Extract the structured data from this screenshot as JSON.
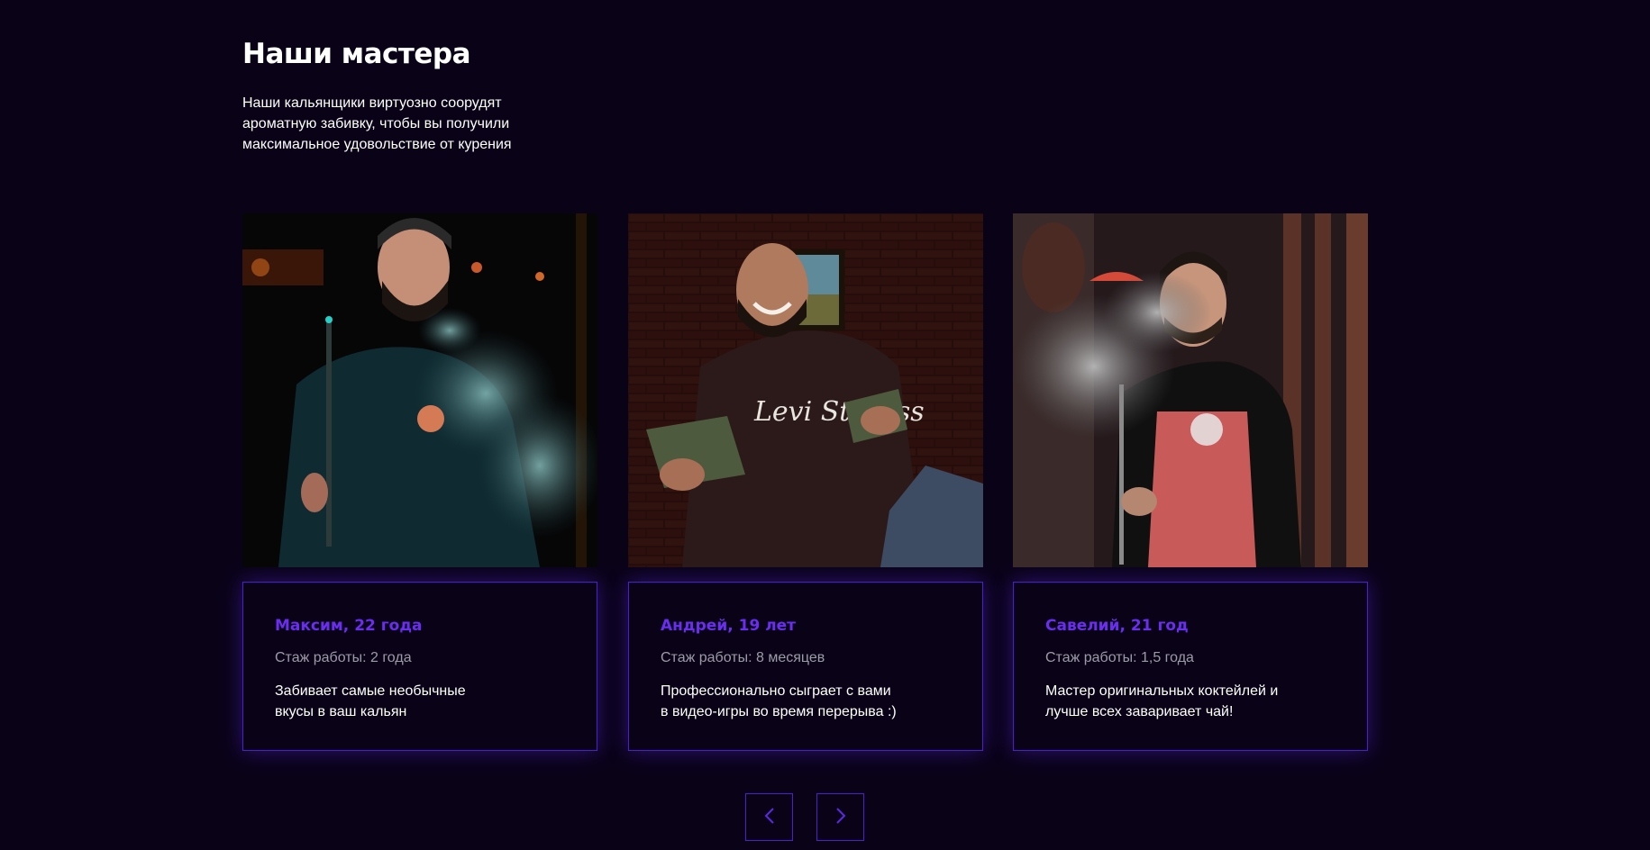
{
  "section": {
    "title": "Наши мастера",
    "description": "Наши кальянщики виртуозно соорудят ароматную забивку, чтобы вы получили максимальное удовольствие от курения"
  },
  "colors": {
    "background": "#0a0318",
    "accent": "#6a2ef0",
    "border": "#4b1fd0",
    "muted_text": "#9d9aa8"
  },
  "masters": [
    {
      "name": "Максим, 22 года",
      "experience": "Стаж работы: 2 года",
      "about": "Забивает самые необычные\nвкусы в ваш кальян"
    },
    {
      "name": "Андрей, 19 лет",
      "experience": "Стаж работы: 8 месяцев",
      "about": "Профессионально сыграет с вами\nв видео-игры во время перерыва :)"
    },
    {
      "name": "Савелий, 21 год",
      "experience": "Стаж работы: 1,5 года",
      "about": "Мастер оригинальных коктейлей и\nлучше всех заваривает чай!"
    }
  ],
  "navigation": {
    "prev_icon": "chevron-left-icon",
    "next_icon": "chevron-right-icon"
  }
}
